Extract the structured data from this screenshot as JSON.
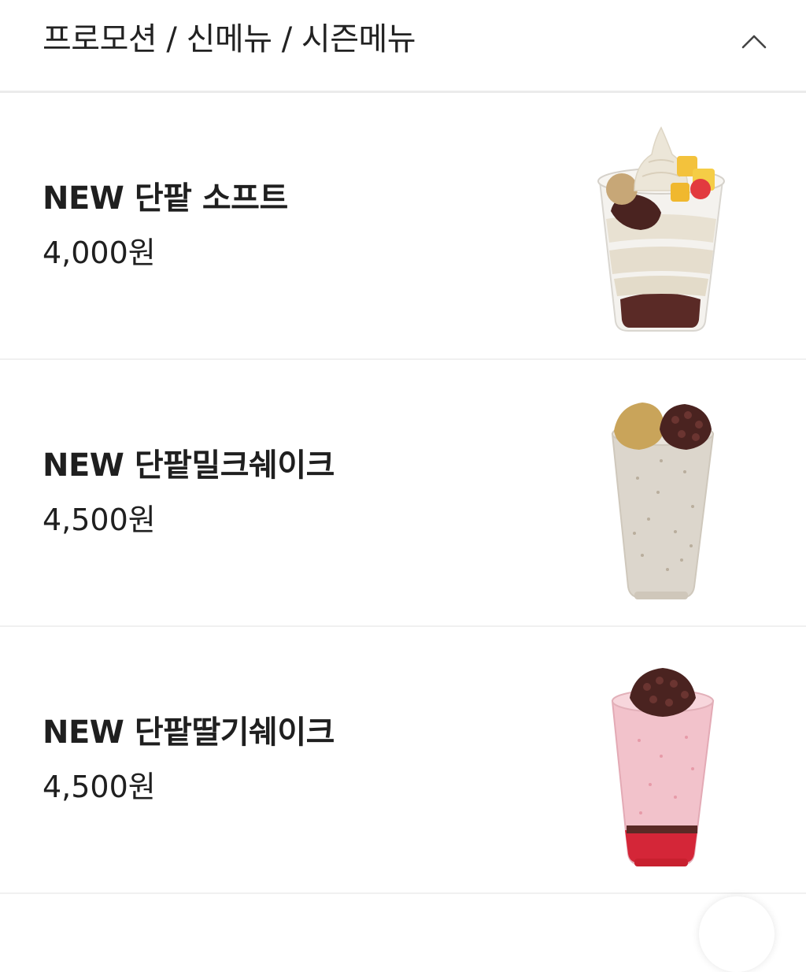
{
  "header": {
    "title": "프로모션 / 신메뉴 / 시즌메뉴",
    "toggle_icon": "chevron-up-icon"
  },
  "menu_items": [
    {
      "name": "NEW 단팥 소프트",
      "price": "4,000원",
      "image": "red-bean-soft-serve-cup"
    },
    {
      "name": "NEW 단팥밀크쉐이크",
      "price": "4,500원",
      "image": "red-bean-milkshake-cup"
    },
    {
      "name": "NEW 단팥딸기쉐이크",
      "price": "4,500원",
      "image": "red-bean-strawberry-shake-cup"
    }
  ],
  "colors": {
    "text": "#1f1f1f",
    "divider": "#ebebeb",
    "background": "#ffffff"
  }
}
